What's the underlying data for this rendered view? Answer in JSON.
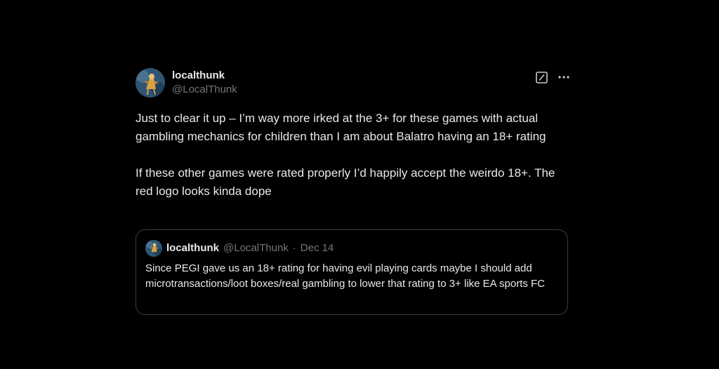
{
  "tweet": {
    "display_name": "localthunk",
    "handle": "@LocalThunk",
    "paragraphs": [
      "Just to clear it up – I’m way more irked at the 3+ for these games with actual gambling mechanics for children than I am about Balatro having an 18+ rating",
      "If these other games were rated properly I’d happily accept the weirdo 18+. The red logo looks kinda dope"
    ],
    "icons": {
      "grok": "grok-icon",
      "more": "more-options-icon"
    }
  },
  "quote": {
    "display_name": "localthunk",
    "handle": "@LocalThunk",
    "separator": "·",
    "date": "Dec 14",
    "text": "Since PEGI gave us an 18+ rating for having evil playing cards maybe I should add microtransactions/loot boxes/real gambling to lower that rating to 3+ like EA sports FC"
  },
  "colors": {
    "background": "#000000",
    "text": "#e7e9ea",
    "secondary": "#71767b",
    "border": "#3a3e42"
  }
}
